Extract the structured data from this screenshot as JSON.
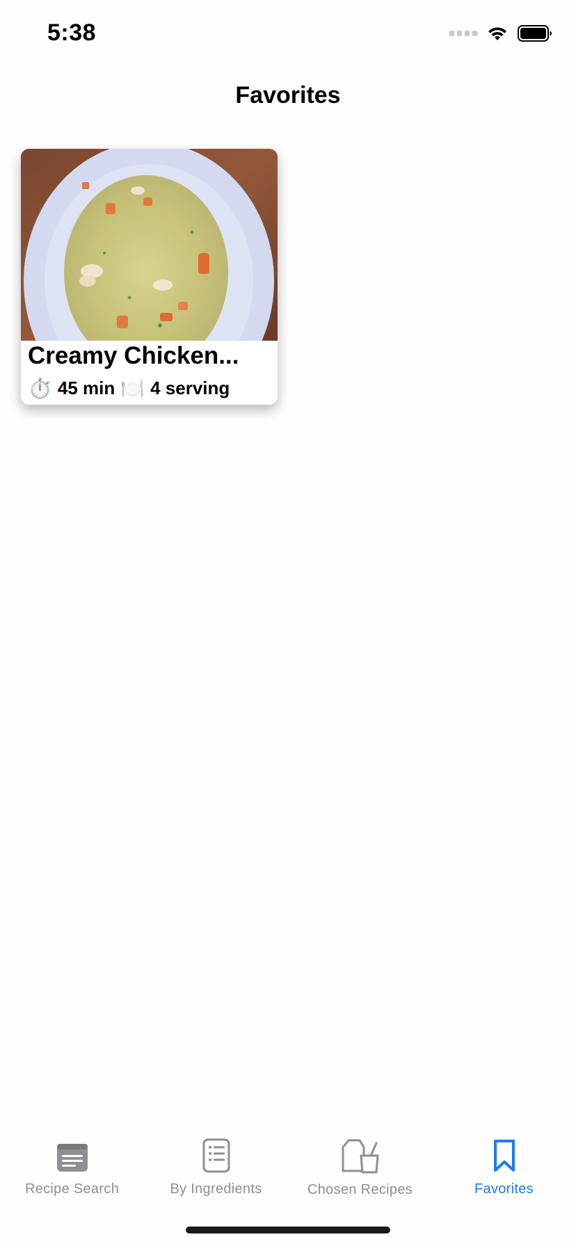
{
  "status_bar": {
    "time": "5:38"
  },
  "nav": {
    "title": "Favorites"
  },
  "favorites": [
    {
      "title": "Creamy Chicken...",
      "time_icon": "stopwatch-icon",
      "time": "45 min",
      "servings_icon": "plate-icon",
      "servings": "4 serving"
    }
  ],
  "tabs": [
    {
      "label": "Recipe Search",
      "icon": "recipe-search-icon",
      "active": false
    },
    {
      "label": "By Ingredients",
      "icon": "list-icon",
      "active": false
    },
    {
      "label": "Chosen Recipes",
      "icon": "blender-icon",
      "active": false
    },
    {
      "label": "Favorites",
      "icon": "bookmark-icon",
      "active": true
    }
  ],
  "colors": {
    "accent": "#1a7cf5",
    "inactive": "#8e8e93",
    "background": "#fefefe"
  }
}
